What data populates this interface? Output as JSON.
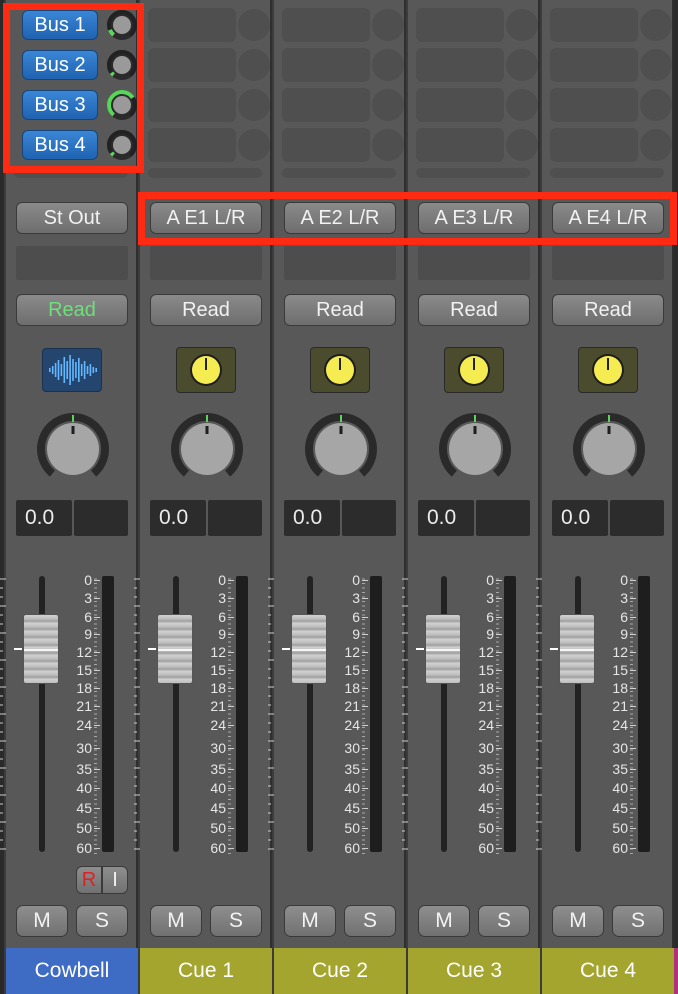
{
  "colors": {
    "strip_bg": "#585858",
    "bus_blue": "#2a74c6",
    "name_blue": "#3e6bc4",
    "name_olive": "#a4a52e",
    "read_green": "#6ee07a",
    "highlight_red": "#ff2a12",
    "knob_yellow": "#f5ec52"
  },
  "fader_scale": [
    "0",
    "3",
    "6",
    "9",
    "12",
    "15",
    "18",
    "21",
    "24",
    "30",
    "35",
    "40",
    "45",
    "50",
    "60"
  ],
  "channels": [
    {
      "name": "Cowbell",
      "name_color": "#3e6bc4",
      "sends": [
        {
          "label": "Bus 1",
          "level": 0.1
        },
        {
          "label": "Bus 2",
          "level": 0.05
        },
        {
          "label": "Bus 3",
          "level": 0.7
        },
        {
          "label": "Bus 4",
          "level": 0.05
        }
      ],
      "output": "St Out",
      "automation": "Read",
      "automation_color": "#6ee07a",
      "plugin_icon": "waveform-icon",
      "volume": "0.0",
      "record_label": "R",
      "input_label": "I",
      "mute": "M",
      "solo": "S"
    },
    {
      "name": "Cue 1",
      "name_color": "#a4a52e",
      "sends": [],
      "output": "A E1 L/R",
      "automation": "Read",
      "automation_color": "#f2f2f2",
      "plugin_icon": "yellow-knob-icon",
      "volume": "0.0",
      "mute": "M",
      "solo": "S"
    },
    {
      "name": "Cue 2",
      "name_color": "#a4a52e",
      "sends": [],
      "output": "A E2 L/R",
      "automation": "Read",
      "automation_color": "#f2f2f2",
      "plugin_icon": "yellow-knob-icon",
      "volume": "0.0",
      "mute": "M",
      "solo": "S"
    },
    {
      "name": "Cue 3",
      "name_color": "#a4a52e",
      "sends": [],
      "output": "A E3 L/R",
      "automation": "Read",
      "automation_color": "#f2f2f2",
      "plugin_icon": "yellow-knob-icon",
      "volume": "0.0",
      "mute": "M",
      "solo": "S"
    },
    {
      "name": "Cue 4",
      "name_color": "#a4a52e",
      "sends": [],
      "output": "A E4 L/R",
      "automation": "Read",
      "automation_color": "#f2f2f2",
      "plugin_icon": "yellow-knob-icon",
      "volume": "0.0",
      "mute": "M",
      "solo": "S"
    }
  ]
}
